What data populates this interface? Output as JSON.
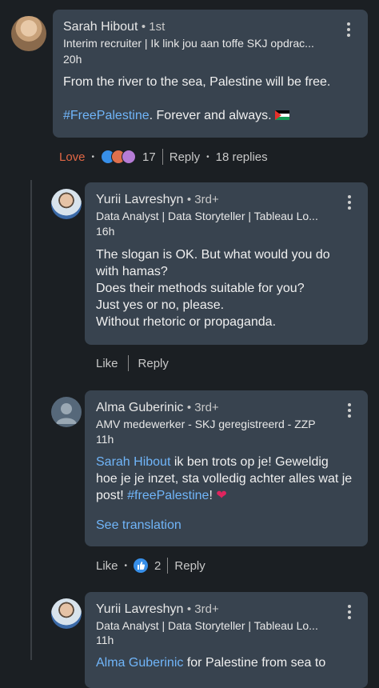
{
  "comments": [
    {
      "name": "Sarah Hibout",
      "degree": "• 1st",
      "headline": "Interim recruiter | Ik link jou aan toffe SKJ opdrac...",
      "time": "20h",
      "line1": "From the river to the sea, Palestine will be free.",
      "hashtag": "#FreePalestine",
      "line2_rest": ". Forever and always.",
      "flag_emoji": "🇵🇸",
      "reaction_label": "Love",
      "reaction_count": "17",
      "reply_label": "Reply",
      "replies_count": "18 replies"
    },
    {
      "name": "Yurii Lavreshyn",
      "degree": "• 3rd+",
      "headline": "Data Analyst | Data Storyteller | Tableau Lo...",
      "time": "16h",
      "lines": [
        "The slogan is OK. But what  would you do",
        "with hamas?",
        "Does their methods suitable for you?",
        "Just yes or no, please.",
        "Without rhetoric or propaganda."
      ],
      "like_label": "Like",
      "reply_label": "Reply"
    },
    {
      "name": "Alma Guberinic",
      "degree": "• 3rd+",
      "headline": "AMV medewerker - SKJ geregistreerd - ZZP",
      "time": "11h",
      "mention": "Sarah Hibout",
      "text_a": " ik ben trots op je! Geweldig",
      "text_b": "hoe je je inzet, sta volledig achter alles wat je",
      "text_c": "post! ",
      "hashtag": "#freePalestine",
      "text_d": "!",
      "heart": "❤️",
      "see_translation": "See translation",
      "like_label": "Like",
      "reaction_count": "2",
      "reply_label": "Reply"
    },
    {
      "name": "Yurii Lavreshyn",
      "degree": "• 3rd+",
      "headline": "Data Analyst | Data Storyteller | Tableau Lo...",
      "time": "11h",
      "partial_mention": "Alma Guberinic",
      "partial_text": " for Palestine from sea to"
    }
  ],
  "colors": {
    "background": "#1b1f23",
    "bubble": "#38434f",
    "link": "#70b5f9",
    "love": "#e16745"
  }
}
